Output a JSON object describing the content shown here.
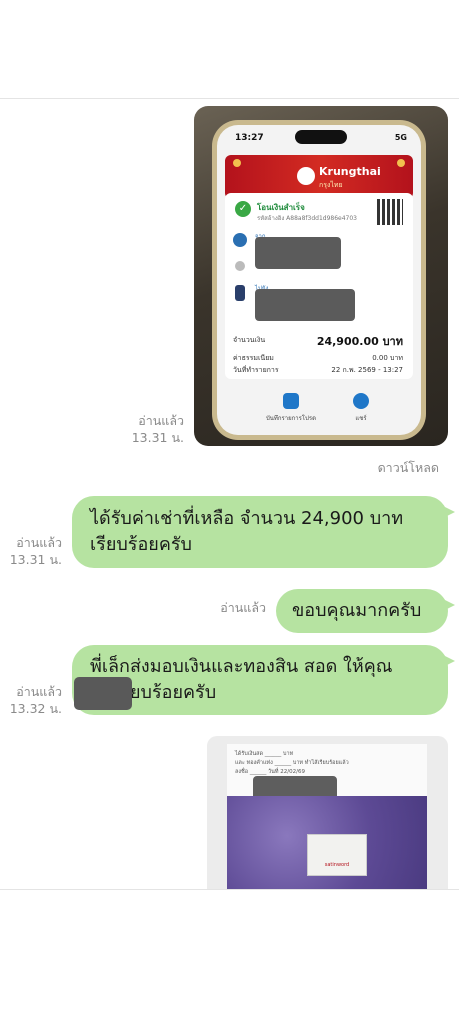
{
  "messages": {
    "photo1": {
      "read_status": "อ่านแล้ว",
      "time": "13.31 น.",
      "slip": {
        "status_time": "13:27",
        "signal": "5G",
        "bank_name": "Krungthai",
        "bank_sub": "กรุงไทย",
        "success_text": "โอนเงินสำเร็จ",
        "ref": "รหัสอ้างอิง A88a8f3dd1d986e4703",
        "from_label": "จาก",
        "to_label": "ไปยัง",
        "amount_label": "จำนวนเงิน",
        "amount_value": "24,900.00 บาท",
        "fee_label": "ค่าธรรมเนียม",
        "fee_value": "0.00 บาท",
        "date_label": "วันที่ทำรายการ",
        "date_value": "22 ก.พ. 2569 - 13:27",
        "save_label": "บันทึกรายการโปรด",
        "share_label": "แชร์"
      }
    },
    "download_label": "ดาวน์โหลด",
    "msg1": {
      "text_line1": "ได้รับค่าเช่าที่เหลือ จำนวน 24,900 บาท",
      "text_line2": "เรียบร้อยครับ",
      "read_status": "อ่านแล้ว",
      "time": "13.31 น."
    },
    "msg2": {
      "text": "ขอบคุณมากครับ",
      "read_status": "อ่านแล้ว"
    },
    "msg3": {
      "text_line1": "พี่เล็กส่งมอบเงินและทองสิน สอด ให้คุณ",
      "text_line2": "ยบร้อยครับ",
      "read_status": "อ่านแล้ว",
      "time": "13.32 น."
    },
    "photo2": {
      "line1": "ได้รับเงินสด ______ บาท",
      "line2": "และ ทองคำแท่ง ______ บาท ทำไส้เรียบร้อยแล้ว",
      "line3": "ลงชื่อ ______ วันที่ 22/02/69",
      "tag_text": "satinword"
    }
  },
  "colors": {
    "bubble": "#b6e3a1",
    "meta_text": "#8a8a8a",
    "redaction": "#5b5b5b",
    "krungthai_red": "#c41a22"
  }
}
